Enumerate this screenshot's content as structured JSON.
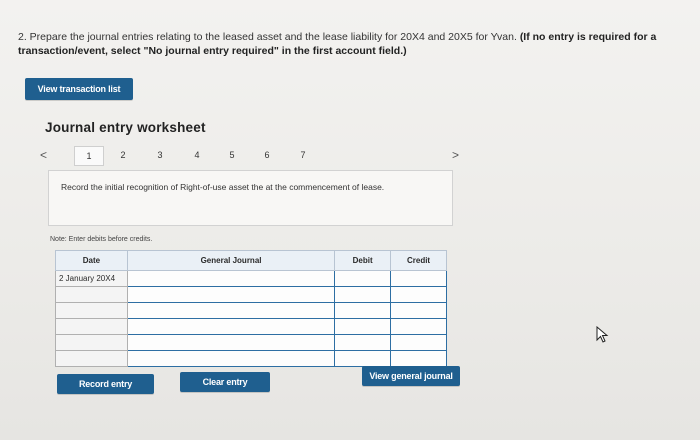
{
  "question": {
    "text": "2. Prepare the journal entries relating to the leased asset and the lease liability for 20X4 and 20X5 for Yvan.",
    "bold": "(If no entry is required for a transaction/event, select \"No journal entry required\" in the first account field.)"
  },
  "buttons": {
    "view_transaction_list": "View transaction list",
    "record_entry": "Record entry",
    "clear_entry": "Clear entry",
    "view_general_journal": "View general journal"
  },
  "worksheet": {
    "title": "Journal entry worksheet",
    "pages": [
      "1",
      "2",
      "3",
      "4",
      "5",
      "6",
      "7"
    ],
    "active_page": "1",
    "prev_arrow": "<",
    "next_arrow": ">",
    "instruction": "Record the initial recognition of Right-of-use asset the at the commencement of lease.",
    "note": "Note: Enter debits before credits."
  },
  "table": {
    "headers": {
      "date": "Date",
      "general_journal": "General Journal",
      "debit": "Debit",
      "credit": "Credit"
    },
    "rows": [
      {
        "date": "2 January 20X4",
        "account": "",
        "debit": "",
        "credit": ""
      },
      {
        "date": "",
        "account": "",
        "debit": "",
        "credit": ""
      },
      {
        "date": "",
        "account": "",
        "debit": "",
        "credit": ""
      },
      {
        "date": "",
        "account": "",
        "debit": "",
        "credit": ""
      },
      {
        "date": "",
        "account": "",
        "debit": "",
        "credit": ""
      },
      {
        "date": "",
        "account": "",
        "debit": "",
        "credit": ""
      }
    ]
  },
  "colors": {
    "button": "#1f5f8f",
    "input_border": "#2d6ea3",
    "header_bg": "#eaf0f6"
  }
}
